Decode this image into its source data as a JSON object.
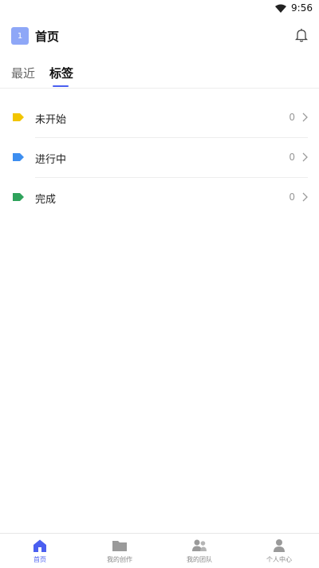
{
  "status_bar": {
    "time": "9:56"
  },
  "header": {
    "badge_text": "1",
    "title": "首页"
  },
  "tabs": [
    {
      "label": "最近",
      "active": false
    },
    {
      "label": "标签",
      "active": true
    }
  ],
  "tag_list": [
    {
      "label": "未开始",
      "count": "0",
      "color": "#f2c500"
    },
    {
      "label": "进行中",
      "count": "0",
      "color": "#3d8ef0"
    },
    {
      "label": "完成",
      "count": "0",
      "color": "#2fa35c"
    }
  ],
  "bottom_nav": [
    {
      "label": "首页",
      "icon": "home-icon",
      "active": true
    },
    {
      "label": "我的创作",
      "icon": "folder-icon",
      "active": false
    },
    {
      "label": "我的团队",
      "icon": "team-icon",
      "active": false
    },
    {
      "label": "个人中心",
      "icon": "user-icon",
      "active": false
    }
  ],
  "colors": {
    "accent": "#4a5ff0",
    "badge": "#8ea7f7"
  }
}
